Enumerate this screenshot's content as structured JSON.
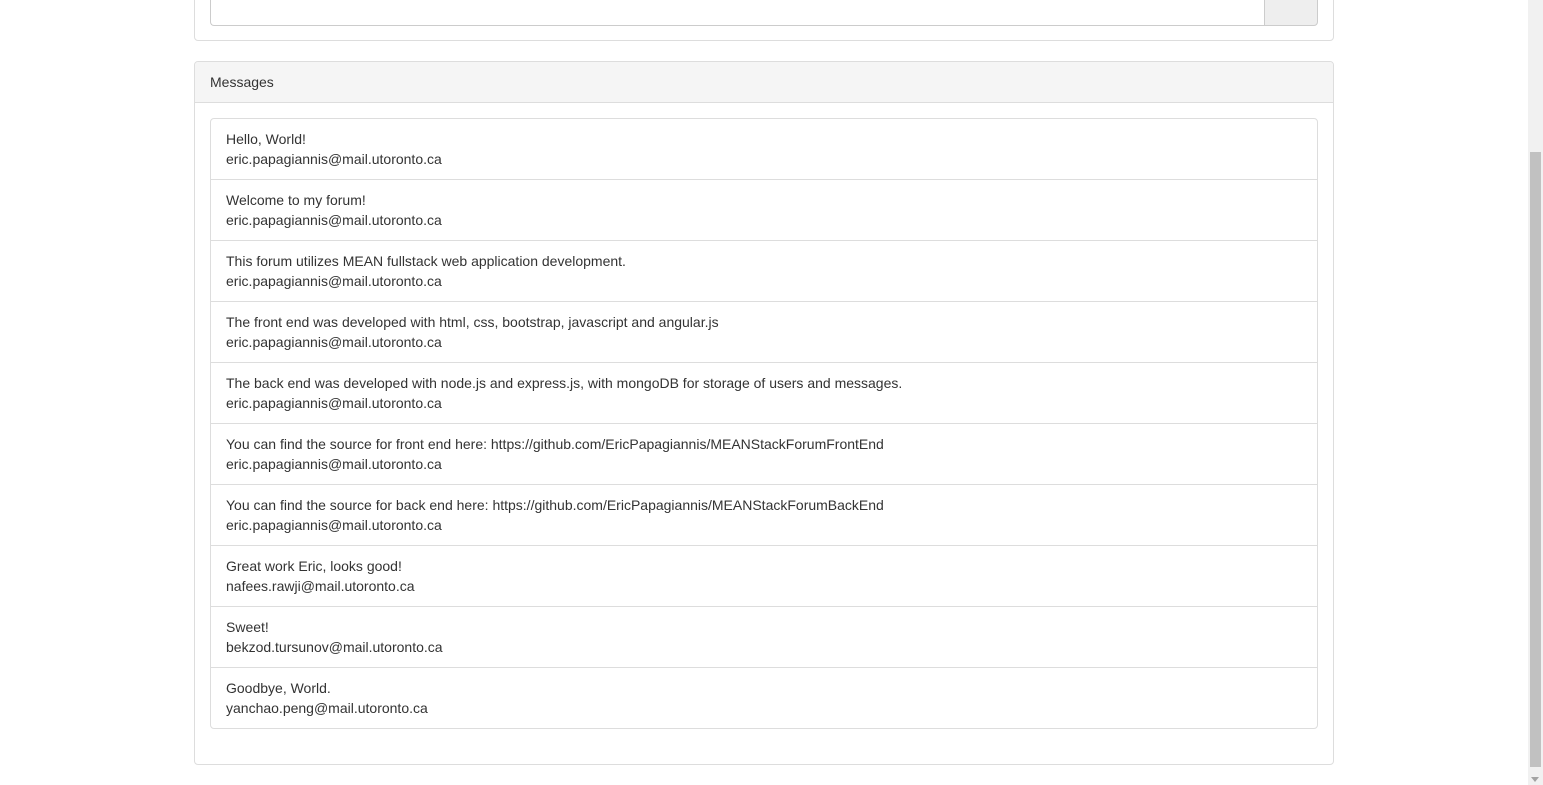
{
  "post_form": {
    "input_value": "",
    "input_placeholder": ""
  },
  "messages_panel": {
    "heading": "Messages",
    "items": [
      {
        "text": "Hello, World!",
        "author": "eric.papagiannis@mail.utoronto.ca"
      },
      {
        "text": "Welcome to my forum!",
        "author": "eric.papagiannis@mail.utoronto.ca"
      },
      {
        "text": "This forum utilizes MEAN fullstack web application development.",
        "author": "eric.papagiannis@mail.utoronto.ca"
      },
      {
        "text": "The front end was developed with html, css, bootstrap, javascript and angular.js",
        "author": "eric.papagiannis@mail.utoronto.ca"
      },
      {
        "text": "The back end was developed with node.js and express.js, with mongoDB for storage of users and messages.",
        "author": "eric.papagiannis@mail.utoronto.ca"
      },
      {
        "text": "You can find the source for front end here: https://github.com/EricPapagiannis/MEANStackForumFrontEnd",
        "author": "eric.papagiannis@mail.utoronto.ca"
      },
      {
        "text": "You can find the source for back end here: https://github.com/EricPapagiannis/MEANStackForumBackEnd",
        "author": "eric.papagiannis@mail.utoronto.ca"
      },
      {
        "text": "Great work Eric, looks good!",
        "author": "nafees.rawji@mail.utoronto.ca"
      },
      {
        "text": "Sweet!",
        "author": "bekzod.tursunov@mail.utoronto.ca"
      },
      {
        "text": "Goodbye, World.",
        "author": "yanchao.peng@mail.utoronto.ca"
      }
    ]
  }
}
